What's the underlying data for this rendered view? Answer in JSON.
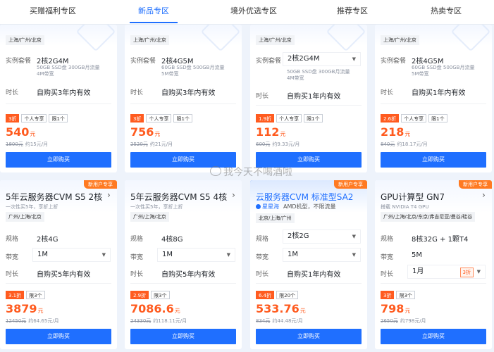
{
  "colors": {
    "accent": "#1f6fff",
    "price": "#ff5b1f",
    "ribbon": "#ff7a22"
  },
  "tabs": [
    {
      "label": "买赠福利专区",
      "active": false
    },
    {
      "label": "新品专区",
      "active": true
    },
    {
      "label": "境外优选专区",
      "active": false
    },
    {
      "label": "推荐专区",
      "active": false
    },
    {
      "label": "热卖专区",
      "active": false
    }
  ],
  "top_cards": [
    {
      "region": "上海/广州/北京",
      "spec_label": "实例套餐",
      "spec": "2核2G4M",
      "spec_note": [
        "50GB SSD盘 300GB月流量",
        "4M带宽"
      ],
      "duration_label": "时长",
      "duration": "自购买3年内有效",
      "badges": [
        "3折",
        "个人专享",
        "限1个"
      ],
      "price": "540",
      "price_unit": "元",
      "orig_price": "1800元",
      "per_month": "约15元/月",
      "buy_label": "立即购买"
    },
    {
      "region": "上海/广州/北京",
      "spec_label": "实例套餐",
      "spec": "2核4G5M",
      "spec_note": [
        "60GB SSD盘 500GB月流量",
        "5M带宽"
      ],
      "duration_label": "时长",
      "duration": "自购买3年内有效",
      "badges": [
        "3折",
        "个人专享",
        "限1个"
      ],
      "price": "756",
      "price_unit": "元",
      "orig_price": "2520元",
      "per_month": "约21元/月",
      "buy_label": "立即购买"
    },
    {
      "region": "上海/广州/北京",
      "spec_label": "实例套餐",
      "spec": "2核2G4M",
      "spec_note": [
        "50GB SSD盘 300GB月流量",
        "4M带宽"
      ],
      "duration_label": "时长",
      "duration": "自购买1年内有效",
      "badges": [
        "1.9折",
        "个人专享",
        "限1个"
      ],
      "price": "112",
      "price_unit": "元",
      "orig_price": "600元",
      "per_month": "约9.33元/月",
      "buy_label": "立即购买"
    },
    {
      "region": "上海/广州/北京",
      "spec_label": "实例套餐",
      "spec": "2核4G5M",
      "spec_note": [
        "60GB SSD盘 500GB月流量",
        "5M带宽"
      ],
      "duration_label": "时长",
      "duration": "自购买1年内有效",
      "badges": [
        "2.6折",
        "个人专享",
        "限1个"
      ],
      "price": "218",
      "price_unit": "元",
      "orig_price": "840元",
      "per_month": "约18.17元/月",
      "buy_label": "立即购买"
    }
  ],
  "bottom_cards": [
    {
      "ribbon": "新用户专享",
      "title": "5年云服务器CVM S5 2核",
      "subtitle": "一次性买5年，享折上折",
      "region": "广州/上海/北京",
      "spec_label": "规格",
      "spec": "2核4G",
      "bandwidth_label": "带宽",
      "bandwidth": "1M",
      "duration_label": "时长",
      "duration": "自购买5年内有效",
      "badges": [
        "3.1折",
        "限3个"
      ],
      "price": "3879",
      "price_unit": "元",
      "orig_price": "12450元",
      "per_month": "约64.65元/月",
      "buy_label": "立即购买"
    },
    {
      "ribbon": "",
      "title": "5年云服务器CVM S5 4核",
      "subtitle": "一次性买5年，享折上折",
      "region": "广州/上海/北京",
      "spec_label": "规格",
      "spec": "4核8G",
      "bandwidth_label": "带宽",
      "bandwidth": "1M",
      "duration_label": "时长",
      "duration": "自购买5年内有效",
      "badges": [
        "2.9折",
        "限3个"
      ],
      "price": "7086.6",
      "price_unit": "元",
      "orig_price": "24330元",
      "per_month": "约118.11元/月",
      "buy_label": "立即购买"
    },
    {
      "ribbon": "新用户专享",
      "title": "云服务器CVM 标准型SA2",
      "brand": "星星海",
      "brand_note": "AMD机型，不限流量",
      "region": "北京/上海/广州",
      "spec_label": "规格",
      "spec": "2核2G",
      "bandwidth_label": "带宽",
      "bandwidth": "1M",
      "duration_label": "时长",
      "duration": "自购买1年内有效",
      "badges": [
        "6.4折",
        "限20个"
      ],
      "price": "533.76",
      "price_unit": "元",
      "orig_price": "834元",
      "per_month": "约44.48元/月",
      "buy_label": "立即购买"
    },
    {
      "ribbon": "新用户专享",
      "title": "GPU计算型 GN7",
      "subtitle": "搭载 NVIDIA T4 GPU",
      "region": "广州/上海/北京/东京/弗吉尼亚/曼谷/硅谷",
      "spec_label": "规格",
      "spec": "8核32G + 1颗T4",
      "bandwidth_label": "带宽",
      "bandwidth": "5M",
      "duration_label": "时长",
      "duration": "1月",
      "duration_tag": "3折",
      "badges": [
        "3折",
        "限3个"
      ],
      "price": "798",
      "price_unit": "元",
      "orig_price": "2650元",
      "per_month": "约798元/月",
      "buy_label": "立即购买"
    }
  ],
  "watermark": "我今天不喝酒啦"
}
